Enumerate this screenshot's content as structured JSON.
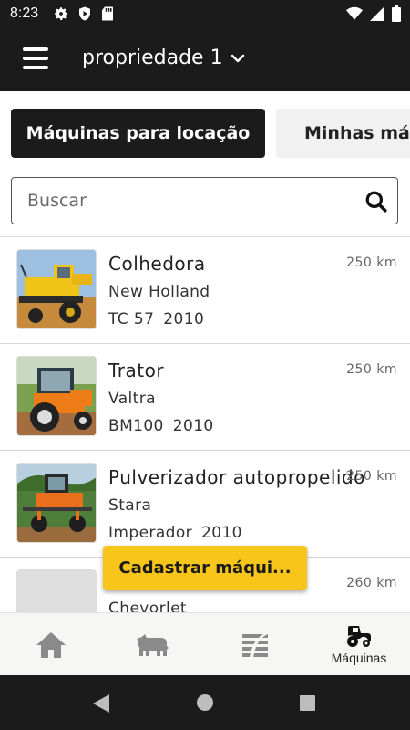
{
  "status_bar": {
    "time": "8:23",
    "left_icons": [
      "settings-icon",
      "shield-play-icon",
      "sd-card-icon"
    ],
    "right_icons": [
      "wifi-icon",
      "cellular-signal-icon",
      "battery-icon"
    ]
  },
  "app_bar": {
    "menu_icon": "hamburger-menu-icon",
    "property_name": "propriedade 1",
    "dropdown_icon": "chevron-down-icon"
  },
  "tabs": [
    {
      "label": "Máquinas para locação",
      "active": true
    },
    {
      "label": "Minhas máquinas",
      "active": false
    }
  ],
  "search": {
    "placeholder": "Buscar",
    "value": ""
  },
  "machines": [
    {
      "title": "Colhedora",
      "brand": "New Holland",
      "model": "TC 57",
      "year": "2010",
      "distance": "250 km",
      "image": "combine-harvester-photo"
    },
    {
      "title": "Trator",
      "brand": "Valtra",
      "model": "BM100",
      "year": "2010",
      "distance": "250 km",
      "image": "tractor-photo"
    },
    {
      "title": "Pulverizador autopropelido",
      "brand": "Stara",
      "model": "Imperador",
      "year": "2010",
      "distance": "250 km",
      "image": "sprayer-photo"
    },
    {
      "title": "",
      "brand": "Chevorlet",
      "model": "",
      "year": "",
      "distance": "260 km",
      "image": "placeholder"
    }
  ],
  "fab": {
    "label": "Cadastrar máqui..."
  },
  "bottom_nav": [
    {
      "icon": "home-icon",
      "label": "",
      "active": false
    },
    {
      "icon": "cattle-icon",
      "label": "",
      "active": false
    },
    {
      "icon": "field-rows-icon",
      "label": "",
      "active": false
    },
    {
      "icon": "tractor-icon",
      "label": "Máquinas",
      "active": true
    }
  ],
  "colors": {
    "dark": "#1b1b1b",
    "accent_yellow": "#f8c61b",
    "nav_inactive": "#7d7d7d",
    "nav_bg": "#f6f6f4"
  }
}
